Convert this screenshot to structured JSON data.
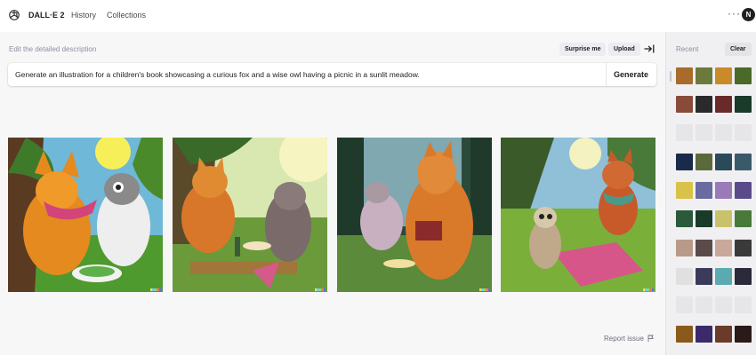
{
  "header": {
    "brand": "DALL·E 2",
    "nav": [
      "History",
      "Collections"
    ],
    "more": "···",
    "avatar_initial": "N"
  },
  "toolbar": {
    "edit_label": "Edit the detailed description",
    "surprise_label": "Surprise me",
    "upload_label": "Upload"
  },
  "prompt": {
    "text": "Generate an illustration for a children's book showcasing a curious fox and a wise owl having a picnic in a sunlit meadow.",
    "generate_label": "Generate"
  },
  "footer": {
    "report_label": "Report issue"
  },
  "sidebar": {
    "recent_label": "Recent",
    "clear_label": "Clear",
    "rows": [
      [
        "#a86b2b",
        "#6b7a3a",
        "#c98a2a",
        "#4b6a2a"
      ],
      [
        "#8a4a3a",
        "#2a2a2a",
        "#6a2a2a",
        "#1a3a2a"
      ],
      [
        "#e6e6e9",
        "#e6e6e9",
        "#e6e6e9",
        "#e6e6e9"
      ],
      [
        "#1a2a4a",
        "#5a6a3a",
        "#2a4a5a",
        "#3a5a6a"
      ],
      [
        "#d9c24a",
        "#6a6aa0",
        "#9a7ab8",
        "#5a4a8a"
      ],
      [
        "#2a5a3a",
        "#1a3a2a",
        "#c9c26a",
        "#4a7a3a"
      ],
      [
        "#b89a8a",
        "#5a4a4a",
        "#c9a89a",
        "#3a3a3a"
      ],
      [
        "#e0e0e0",
        "#3a3a5a",
        "#5aaab0",
        "#2a2a3a"
      ],
      [
        "#e6e6e9",
        "#e6e6e9",
        "#e6e6e9",
        "#e6e6e9"
      ],
      [
        "#8a5a1a",
        "#3a2a6a",
        "#6a3a2a",
        "#2a1a1a"
      ]
    ]
  },
  "colors": {
    "sidebar_bg": "#f0f0f2",
    "main_bg": "#f7f7f8",
    "button_bg": "#ececf1",
    "text_primary": "#202123",
    "text_muted": "#8e8ea0"
  },
  "images": [
    "fox-and-owl-picnic-1",
    "fox-and-owl-picnic-2",
    "fox-and-owl-picnic-3",
    "fox-and-owl-picnic-4"
  ]
}
